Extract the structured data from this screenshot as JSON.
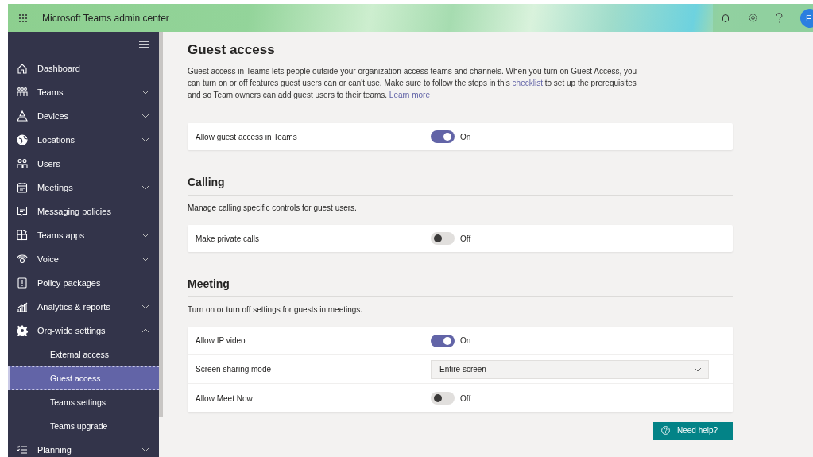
{
  "header": {
    "title": "Microsoft Teams admin center",
    "avatar": "E"
  },
  "sidebar": {
    "items": [
      {
        "label": "Dashboard",
        "expandable": false
      },
      {
        "label": "Teams",
        "expandable": true,
        "expanded": false
      },
      {
        "label": "Devices",
        "expandable": true,
        "expanded": false
      },
      {
        "label": "Locations",
        "expandable": true,
        "expanded": false
      },
      {
        "label": "Users",
        "expandable": false
      },
      {
        "label": "Meetings",
        "expandable": true,
        "expanded": false
      },
      {
        "label": "Messaging policies",
        "expandable": false
      },
      {
        "label": "Teams apps",
        "expandable": true,
        "expanded": false
      },
      {
        "label": "Voice",
        "expandable": true,
        "expanded": false
      },
      {
        "label": "Policy packages",
        "expandable": false
      },
      {
        "label": "Analytics & reports",
        "expandable": true,
        "expanded": false
      },
      {
        "label": "Org-wide settings",
        "expandable": true,
        "expanded": true,
        "children": [
          {
            "label": "External access",
            "selected": false
          },
          {
            "label": "Guest access",
            "selected": true
          },
          {
            "label": "Teams settings",
            "selected": false
          },
          {
            "label": "Teams upgrade",
            "selected": false
          }
        ]
      },
      {
        "label": "Planning",
        "expandable": true,
        "expanded": false
      }
    ]
  },
  "page": {
    "title": "Guest access",
    "intro": [
      {
        "kind": "text",
        "text": "Guest access in Teams lets people outside your organization access teams and channels. When you turn on Guest Access, you can turn on or off features guest users can or can't use. Make sure to follow the steps in this "
      },
      {
        "kind": "link",
        "text": "checklist"
      },
      {
        "kind": "text",
        "text": " to set up the prerequisites and so Team owners can add guest users to their teams. "
      },
      {
        "kind": "link",
        "text": "Learn more"
      }
    ],
    "sections": [
      {
        "rows": [
          {
            "kind": "toggle",
            "label": "Allow guest access in Teams",
            "on": true,
            "state_text": "On"
          }
        ]
      },
      {
        "heading": "Calling",
        "description": "Manage calling specific controls for guest users.",
        "rows": [
          {
            "kind": "toggle",
            "label": "Make private calls",
            "on": false,
            "state_text": "Off"
          }
        ]
      },
      {
        "heading": "Meeting",
        "description": "Turn on or turn off settings for guests in meetings.",
        "rows": [
          {
            "kind": "toggle",
            "label": "Allow IP video",
            "on": true,
            "state_text": "On"
          },
          {
            "kind": "dropdown",
            "label": "Screen sharing mode",
            "value": "Entire screen"
          },
          {
            "kind": "toggle",
            "label": "Allow Meet Now",
            "on": false,
            "state_text": "Off"
          }
        ]
      }
    ]
  },
  "help_button": "Need help?"
}
